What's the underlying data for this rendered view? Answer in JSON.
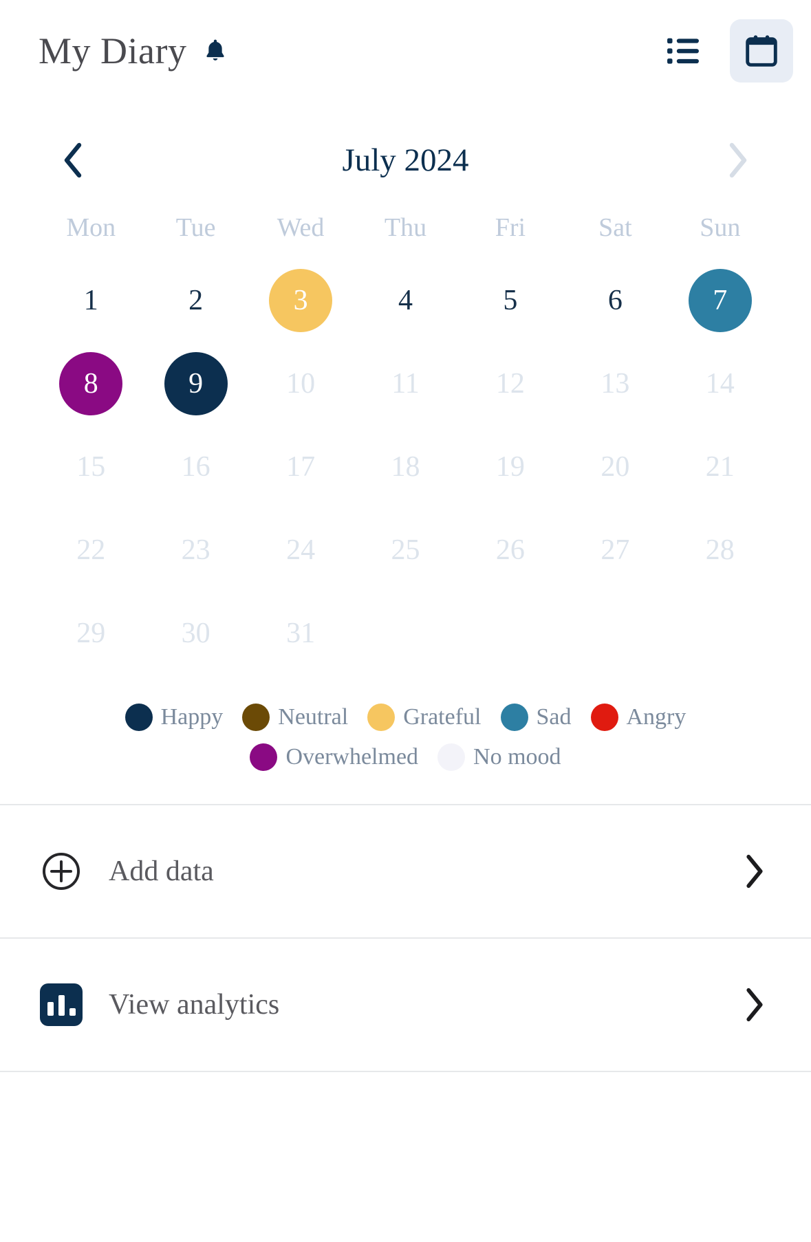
{
  "header": {
    "title": "My Diary",
    "bell_icon": "bell-icon",
    "actions": [
      {
        "name": "list-view-icon",
        "label": "List view",
        "active": false
      },
      {
        "name": "calendar-view-icon",
        "label": "Calendar view",
        "active": true
      }
    ]
  },
  "calendar": {
    "prev_label": "‹",
    "next_label": "›",
    "month_label": "July 2024",
    "weekdays": [
      "Mon",
      "Tue",
      "Wed",
      "Thu",
      "Fri",
      "Sat",
      "Sun"
    ],
    "weeks": [
      [
        {
          "day": "1",
          "state": "plain"
        },
        {
          "day": "2",
          "state": "plain"
        },
        {
          "day": "3",
          "state": "filled",
          "mood": "Grateful",
          "color": "#f6c660"
        },
        {
          "day": "4",
          "state": "plain"
        },
        {
          "day": "5",
          "state": "plain"
        },
        {
          "day": "6",
          "state": "plain"
        },
        {
          "day": "7",
          "state": "filled",
          "mood": "Sad",
          "color": "#2d7fa3"
        }
      ],
      [
        {
          "day": "8",
          "state": "filled",
          "mood": "Overwhelmed",
          "color": "#8a0a83"
        },
        {
          "day": "9",
          "state": "filled",
          "mood": "Happy",
          "color": "#0c2f4f"
        },
        {
          "day": "10",
          "state": "dim"
        },
        {
          "day": "11",
          "state": "dim"
        },
        {
          "day": "12",
          "state": "dim"
        },
        {
          "day": "13",
          "state": "dim"
        },
        {
          "day": "14",
          "state": "dim"
        }
      ],
      [
        {
          "day": "15",
          "state": "dim"
        },
        {
          "day": "16",
          "state": "dim"
        },
        {
          "day": "17",
          "state": "dim"
        },
        {
          "day": "18",
          "state": "dim"
        },
        {
          "day": "19",
          "state": "dim"
        },
        {
          "day": "20",
          "state": "dim"
        },
        {
          "day": "21",
          "state": "dim"
        }
      ],
      [
        {
          "day": "22",
          "state": "dim"
        },
        {
          "day": "23",
          "state": "dim"
        },
        {
          "day": "24",
          "state": "dim"
        },
        {
          "day": "25",
          "state": "dim"
        },
        {
          "day": "26",
          "state": "dim"
        },
        {
          "day": "27",
          "state": "dim"
        },
        {
          "day": "28",
          "state": "dim"
        }
      ],
      [
        {
          "day": "29",
          "state": "dim"
        },
        {
          "day": "30",
          "state": "dim"
        },
        {
          "day": "31",
          "state": "dim"
        },
        {
          "day": "",
          "state": "empty"
        },
        {
          "day": "",
          "state": "empty"
        },
        {
          "day": "",
          "state": "empty"
        },
        {
          "day": "",
          "state": "empty"
        }
      ]
    ]
  },
  "legend": {
    "rows": [
      [
        {
          "label": "Happy",
          "color": "#0c2f4f"
        },
        {
          "label": "Neutral",
          "color": "#6b4a06"
        },
        {
          "label": "Grateful",
          "color": "#f6c660"
        },
        {
          "label": "Sad",
          "color": "#2d7fa3"
        },
        {
          "label": "Angry",
          "color": "#e01b10"
        }
      ],
      [
        {
          "label": "Overwhelmed",
          "color": "#8a0a83"
        },
        {
          "label": "No mood",
          "color": "#f3f3f9"
        }
      ]
    ]
  },
  "list": {
    "rows": [
      {
        "label": "Add data",
        "icon": "plus-circle-icon",
        "chevron": "chevron-right-icon"
      },
      {
        "label": "View analytics",
        "icon": "bar-chart-icon",
        "chevron": "chevron-right-icon"
      }
    ]
  },
  "colors": {
    "navy": "#0c2f4f",
    "muted_text": "#7b8a9c",
    "dim_day": "#dde4ec",
    "active_tab_bg": "#e8edf5",
    "divider": "#e6e8ea"
  }
}
